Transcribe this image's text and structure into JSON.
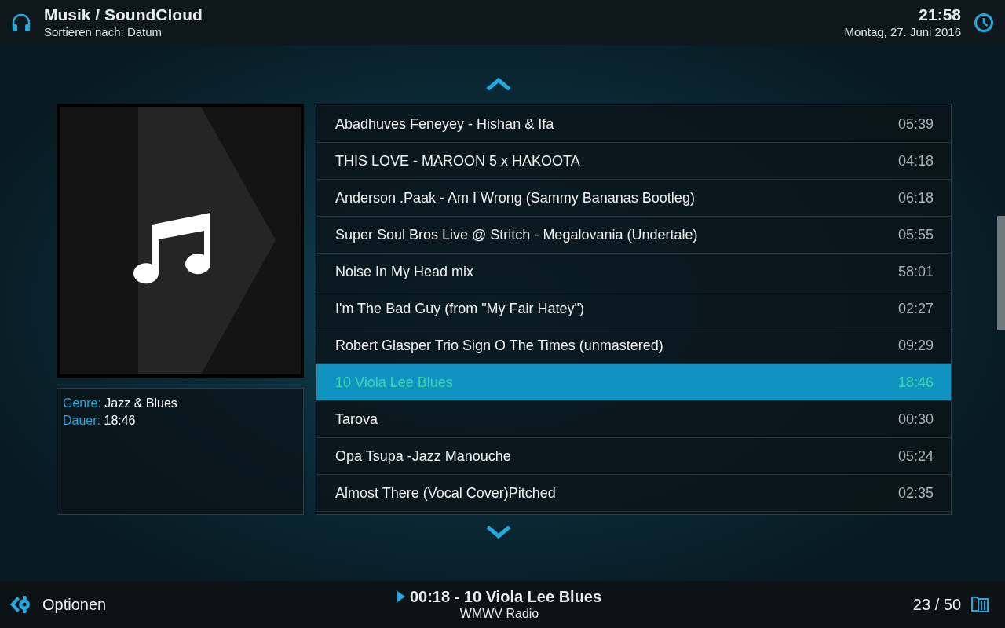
{
  "header": {
    "title": "Musik / SoundCloud",
    "subtitle": "Sortieren nach: Datum",
    "time": "21:58",
    "date": "Montag, 27. Juni 2016"
  },
  "thumbnail": {
    "kind": "music-note"
  },
  "info": [
    {
      "label": "Genre:",
      "value": "Jazz & Blues"
    },
    {
      "label": "Dauer:",
      "value": "18:46"
    }
  ],
  "tracks": [
    {
      "title": "Abadhuves Feneyey - Hishan & Ifa",
      "duration": "05:39",
      "selected": false
    },
    {
      "title": "THIS LOVE - MAROON 5 x HAKOOTA",
      "duration": "04:18",
      "selected": false
    },
    {
      "title": "Anderson .Paak - Am I Wrong (Sammy Bananas Bootleg)",
      "duration": "06:18",
      "selected": false
    },
    {
      "title": "Super Soul Bros Live @ Stritch - Megalovania (Undertale)",
      "duration": "05:55",
      "selected": false
    },
    {
      "title": "Noise In My Head mix",
      "duration": "58:01",
      "selected": false
    },
    {
      "title": "I'm The Bad Guy (from \"My Fair Hatey\")",
      "duration": "02:27",
      "selected": false
    },
    {
      "title": "Robert Glasper Trio Sign O The Times (unmastered)",
      "duration": "09:29",
      "selected": false
    },
    {
      "title": "10 Viola Lee Blues",
      "duration": "18:46",
      "selected": true
    },
    {
      "title": "Tarova",
      "duration": "00:30",
      "selected": false
    },
    {
      "title": "Opa Tsupa -Jazz Manouche",
      "duration": "05:24",
      "selected": false
    },
    {
      "title": "Almost There (Vocal Cover)Pitched",
      "duration": "02:35",
      "selected": false
    }
  ],
  "footer": {
    "options_label": "Optionen",
    "now_playing": "00:18 - 10 Viola Lee Blues",
    "station": "WMWV Radio",
    "page_count": "23 / 50"
  }
}
